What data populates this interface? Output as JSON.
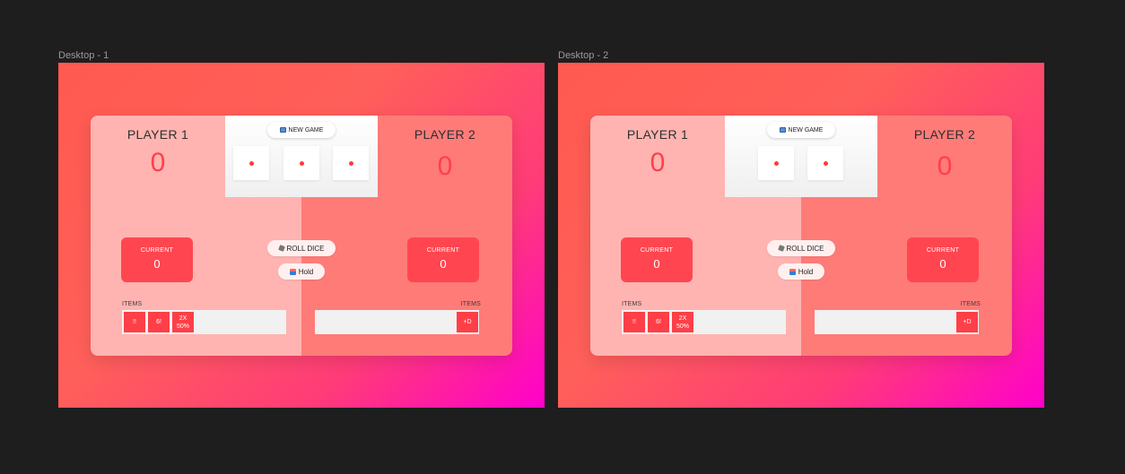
{
  "frames": [
    {
      "label": "Desktop - 1",
      "player1": {
        "name": "PLAYER 1",
        "score": "0",
        "current_label": "CURRENT",
        "current_value": "0",
        "items_label": "ITEMS",
        "items": [
          {
            "text": "!!"
          },
          {
            "text": "6!"
          },
          {
            "text": "2X",
            "sub": "50%"
          }
        ]
      },
      "player2": {
        "name": "PLAYER 2",
        "score": "0",
        "current_label": "CURRENT",
        "current_value": "0",
        "items_label": "ITEMS",
        "items": [
          {
            "text": "+D"
          }
        ]
      },
      "new_game": "NEW GAME",
      "roll_dice": "ROLL DICE",
      "hold": "Hold",
      "dice_count": 3
    },
    {
      "label": "Desktop - 2",
      "player1": {
        "name": "PLAYER 1",
        "score": "0",
        "current_label": "CURRENT",
        "current_value": "0",
        "items_label": "ITEMS",
        "items": [
          {
            "text": "!!"
          },
          {
            "text": "6!"
          },
          {
            "text": "2X",
            "sub": "50%"
          }
        ]
      },
      "player2": {
        "name": "PLAYER 2",
        "score": "0",
        "current_label": "CURRENT",
        "current_value": "0",
        "items_label": "ITEMS",
        "items": [
          {
            "text": "+D"
          }
        ]
      },
      "new_game": "NEW GAME",
      "roll_dice": "ROLL DICE",
      "hold": "Hold",
      "dice_count": 2
    }
  ],
  "colors": {
    "canvas": "#1e1e1e",
    "gradient_start": "#ff5a50",
    "gradient_end": "#ff00cc",
    "player1_panel": "#ffb4b1",
    "player2_panel": "#ff7b78",
    "accent": "#ff4650",
    "pip": "#ff3b3b"
  },
  "icons": {
    "new_game": "new-game-icon",
    "roll_dice": "dice-icon",
    "hold": "hold-icon"
  }
}
